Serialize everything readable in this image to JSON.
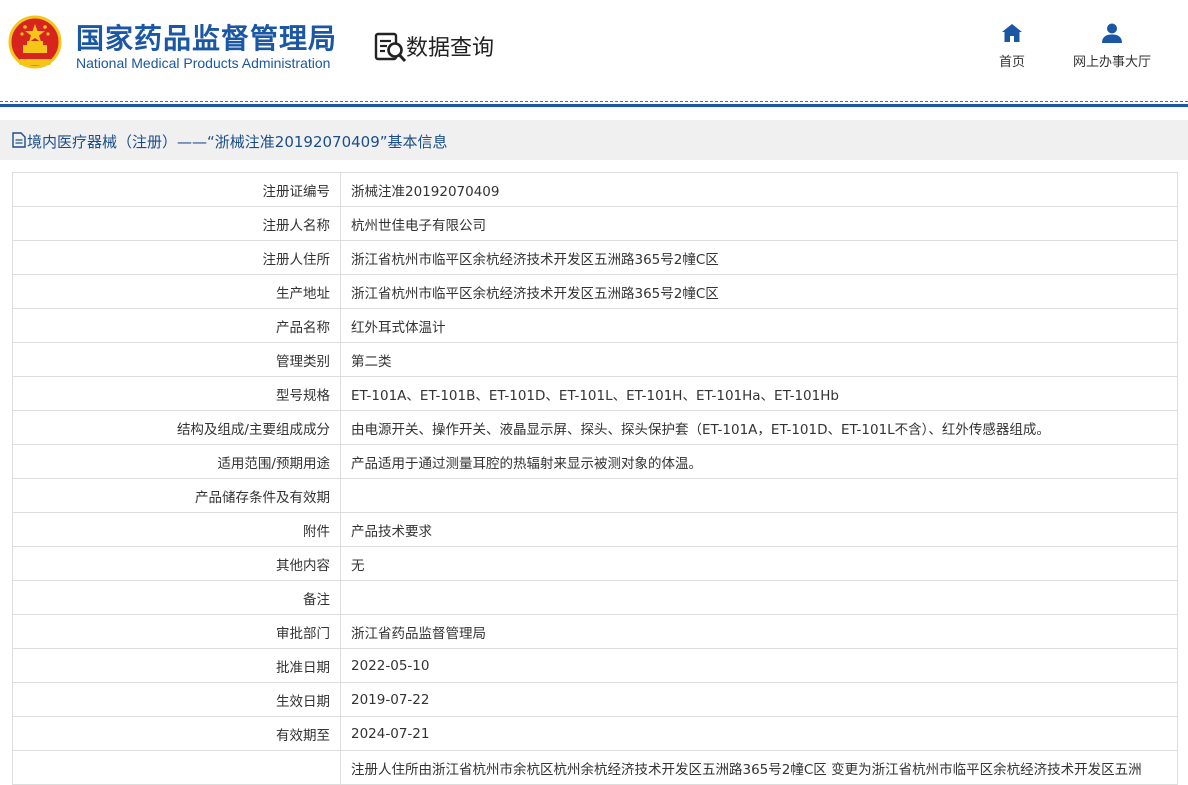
{
  "header": {
    "org_name_cn": "国家药品监督管理局",
    "org_name_en": "National Medical Products Administration",
    "section_title": "数据查询",
    "nav": [
      {
        "label": "首页",
        "icon": "home-icon"
      },
      {
        "label": "网上办事大厅",
        "icon": "user-icon"
      }
    ]
  },
  "colors": {
    "brand_blue": "#1b57a5",
    "title_bar_bg": "#f0f0f0",
    "emblem_red": "#d7241e",
    "emblem_gold": "#f5c518"
  },
  "title_bar": {
    "text": "境内医疗器械（注册）——“浙械注准20192070409”基本信息",
    "icon": "document-icon"
  },
  "record": {
    "rows": [
      {
        "label": "注册证编号",
        "value": "浙械注准20192070409"
      },
      {
        "label": "注册人名称",
        "value": "杭州世佳电子有限公司"
      },
      {
        "label": "注册人住所",
        "value": "浙江省杭州市临平区余杭经济技术开发区五洲路365号2幢C区"
      },
      {
        "label": "生产地址",
        "value": "浙江省杭州市临平区余杭经济技术开发区五洲路365号2幢C区"
      },
      {
        "label": "产品名称",
        "value": "红外耳式体温计"
      },
      {
        "label": "管理类别",
        "value": "第二类"
      },
      {
        "label": "型号规格",
        "value": "ET-101A、ET-101B、ET-101D、ET-101L、ET-101H、ET-101Ha、ET-101Hb"
      },
      {
        "label": "结构及组成/主要组成成分",
        "value": "由电源开关、操作开关、液晶显示屏、探头、探头保护套（ET-101A，ET-101D、ET-101L不含）、红外传感器组成。"
      },
      {
        "label": "适用范围/预期用途",
        "value": "产品适用于通过测量耳腔的热辐射来显示被测对象的体温。"
      },
      {
        "label": "产品储存条件及有效期",
        "value": ""
      },
      {
        "label": "附件",
        "value": "产品技术要求"
      },
      {
        "label": "其他内容",
        "value": "无"
      },
      {
        "label": "备注",
        "value": ""
      },
      {
        "label": "审批部门",
        "value": "浙江省药品监督管理局"
      },
      {
        "label": "批准日期",
        "value": "2022-05-10"
      },
      {
        "label": "生效日期",
        "value": "2019-07-22"
      },
      {
        "label": "有效期至",
        "value": "2024-07-21"
      },
      {
        "label": "",
        "value": "注册人住所由浙江省杭州市余杭区杭州余杭经济技术开发区五洲路365号2幢C区 变更为浙江省杭州市临平区余杭经济技术开发区五洲"
      }
    ]
  }
}
